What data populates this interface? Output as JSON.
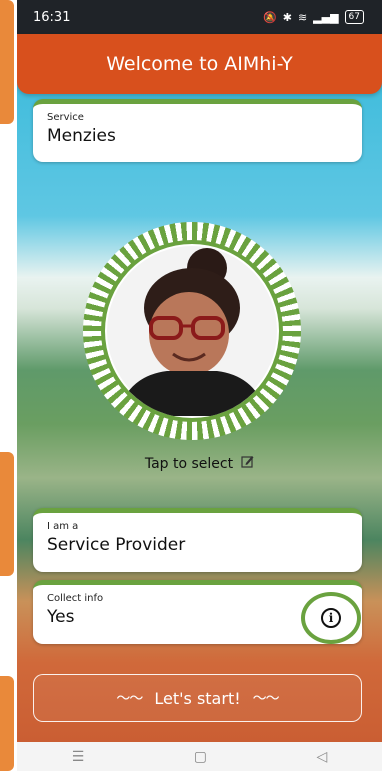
{
  "status": {
    "time": "16:31",
    "battery": "67"
  },
  "header": {
    "title": "Welcome to AIMhi-Y"
  },
  "service": {
    "label": "Service",
    "value": "Menzies"
  },
  "avatar": {
    "tap_label": "Tap to select"
  },
  "role": {
    "label": "I am a",
    "value": "Service Provider"
  },
  "collect": {
    "label": "Collect info",
    "value": "Yes"
  },
  "start": {
    "label": "Let's start!"
  },
  "colors": {
    "header": "#d8501d",
    "accent": "#6aa23f"
  }
}
